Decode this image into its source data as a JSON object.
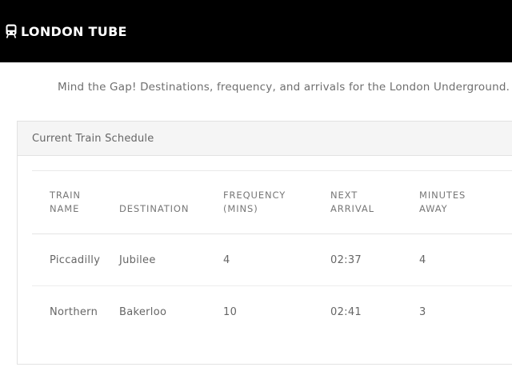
{
  "brand": {
    "icon": "train-icon",
    "title": "LONDON TUBE"
  },
  "tagline": "Mind the Gap! Destinations, frequency, and arrivals for the London Underground.",
  "panel": {
    "heading": "Current Train Schedule"
  },
  "table": {
    "headers": [
      [
        "TRAIN",
        "NAME"
      ],
      [
        "DESTINATION"
      ],
      [
        "FREQUENCY",
        "(MINS)"
      ],
      [
        "NEXT",
        "ARRIVAL"
      ],
      [
        "MINUTES",
        "AWAY"
      ]
    ],
    "rows": [
      [
        "Piccadilly",
        "Jubilee",
        "4",
        "02:37",
        "4"
      ],
      [
        "Northern",
        "Bakerloo",
        "10",
        "02:41",
        "3"
      ]
    ]
  }
}
